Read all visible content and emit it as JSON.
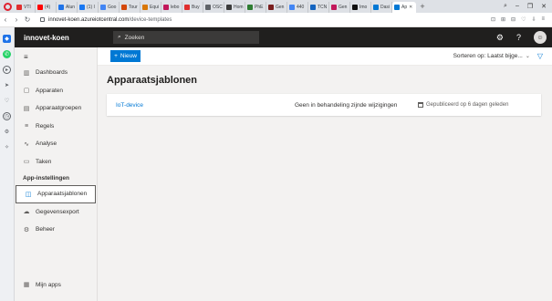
{
  "browser": {
    "tabs": [
      {
        "label": "VTI",
        "color": "#e02e2e"
      },
      {
        "label": "(4)",
        "color": "#ff0000"
      },
      {
        "label": "Alun",
        "color": "#1f73e8"
      },
      {
        "label": "(1) I",
        "color": "#1877f2"
      },
      {
        "label": "Goo",
        "color": "#4285f4"
      },
      {
        "label": "Tour",
        "color": "#d4480a"
      },
      {
        "label": "Equi",
        "color": "#d97706"
      },
      {
        "label": "lebo",
        "color": "#c2185b"
      },
      {
        "label": "Buy",
        "color": "#e02e2e"
      },
      {
        "label": "OSC",
        "color": "#5f6368"
      },
      {
        "label": "Hom",
        "color": "#3b3b3b"
      },
      {
        "label": "PhE",
        "color": "#2e7d32"
      },
      {
        "label": "Gen",
        "color": "#7a1f1f"
      },
      {
        "label": "440",
        "color": "#4285f4"
      },
      {
        "label": "TCN",
        "color": "#1565c0"
      },
      {
        "label": "Gen",
        "color": "#c2185b"
      },
      {
        "label": "Imo",
        "color": "#111111"
      },
      {
        "label": "Dasi",
        "color": "#0078d4"
      },
      {
        "label": "Ap",
        "color": "#0078d4"
      }
    ],
    "url_host": "innovet-koen.azureiotcentral.com",
    "url_path": "/device-templates"
  },
  "app": {
    "title": "innovet-koen",
    "search_placeholder": "Zoeken",
    "avatar_initial": "☺"
  },
  "nav": {
    "items": [
      {
        "label": "Dashboards",
        "icon": "dashboard-icon",
        "glyph": "▥"
      },
      {
        "label": "Apparaten",
        "icon": "devices-icon",
        "glyph": "▢"
      },
      {
        "label": "Apparaatgroepen",
        "icon": "device-groups-icon",
        "glyph": "▤"
      },
      {
        "label": "Regels",
        "icon": "rules-icon",
        "glyph": "≡"
      },
      {
        "label": "Analyse",
        "icon": "analytics-icon",
        "glyph": "∿"
      },
      {
        "label": "Taken",
        "icon": "jobs-icon",
        "glyph": "▭"
      }
    ],
    "section_label": "App-instellingen",
    "settings_items": [
      {
        "label": "Apparaatsjablonen",
        "icon": "device-templates-icon",
        "glyph": "◫"
      },
      {
        "label": "Gegevensexport",
        "icon": "data-export-icon",
        "glyph": "☁"
      },
      {
        "label": "Beheer",
        "icon": "administration-icon",
        "glyph": "⚙"
      }
    ],
    "my_apps": {
      "label": "Mijn apps",
      "icon": "my-apps-icon",
      "glyph": "▦"
    }
  },
  "toolbar": {
    "new_label": "Nieuw",
    "sort_label": "Sorteren op: Laatst bijge..."
  },
  "main": {
    "title": "Apparaatsjablonen",
    "templates": [
      {
        "name": "IoT-device",
        "status": "Geen in behandeling zijnde wijzigingen",
        "published": "Gepubliceerd op 6 dagen geleden"
      }
    ]
  },
  "colors": {
    "accent": "#0078d4",
    "header_bg": "#201f1e"
  }
}
